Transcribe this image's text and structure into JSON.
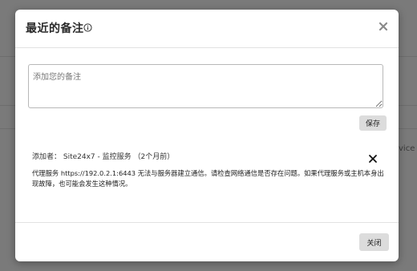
{
  "background": {
    "partial_text": "vice h"
  },
  "modal": {
    "title": "最近的备注",
    "note_input": {
      "placeholder": "添加您的备注",
      "value": ""
    },
    "save_label": "保存",
    "note": {
      "meta": "添加者： Site24x7 - 监控服务 （2个月前）",
      "body": "代理服务 https://192.0.2.1:6443 无法与服务器建立通信。请检查网络通信是否存在问题。如果代理服务或主机本身出现故障，也可能会发生这种情况。"
    },
    "close_label": "关闭"
  }
}
